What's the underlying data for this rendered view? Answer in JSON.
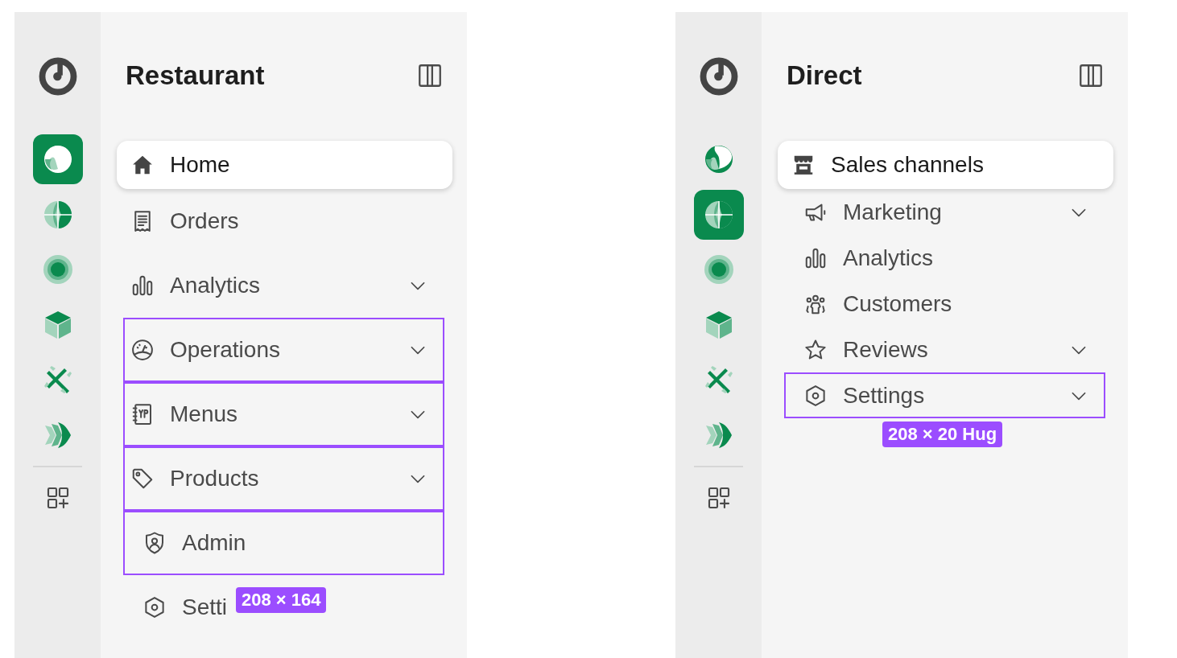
{
  "panels": [
    {
      "title": "Restaurant",
      "rail": [
        {
          "selected": true
        },
        {
          "selected": false
        },
        {
          "selected": false
        },
        {
          "selected": false
        },
        {
          "selected": false
        },
        {
          "selected": false
        }
      ],
      "items": [
        {
          "kind": "item",
          "label": "Home",
          "selected": true,
          "expandable": false,
          "outlined": false
        },
        {
          "kind": "item",
          "label": "Orders",
          "selected": false,
          "expandable": false,
          "outlined": false
        },
        {
          "kind": "item",
          "label": "Analytics",
          "selected": false,
          "expandable": true,
          "outlined": false
        },
        {
          "kind": "item",
          "label": "Operations",
          "selected": false,
          "expandable": true,
          "outlined": true
        },
        {
          "kind": "item",
          "label": "Menus",
          "selected": false,
          "expandable": true,
          "outlined": true
        },
        {
          "kind": "item",
          "label": "Products",
          "selected": false,
          "expandable": true,
          "outlined": true
        },
        {
          "kind": "sub",
          "label": "Admin",
          "selected": false,
          "expandable": false,
          "outlined": true
        },
        {
          "kind": "sub",
          "label": "Setti",
          "selected": false,
          "expandable": false,
          "outlined": false
        }
      ],
      "size_badge": "208 × 164"
    },
    {
      "title": "Direct",
      "rail": [
        {
          "selected": false
        },
        {
          "selected": true
        },
        {
          "selected": false
        },
        {
          "selected": false
        },
        {
          "selected": false
        },
        {
          "selected": false
        }
      ],
      "items": [
        {
          "kind": "item",
          "label": "Sales channels",
          "selected": true,
          "expandable": false,
          "outlined": false
        },
        {
          "kind": "sub",
          "label": "Marketing",
          "selected": false,
          "expandable": true,
          "outlined": false
        },
        {
          "kind": "sub",
          "label": "Analytics",
          "selected": false,
          "expandable": false,
          "outlined": false
        },
        {
          "kind": "sub",
          "label": "Customers",
          "selected": false,
          "expandable": false,
          "outlined": false
        },
        {
          "kind": "sub",
          "label": "Reviews",
          "selected": false,
          "expandable": true,
          "outlined": false
        },
        {
          "kind": "sub",
          "label": "Settings",
          "selected": false,
          "expandable": true,
          "outlined": true
        }
      ],
      "size_badge": "208 × 20 Hug"
    }
  ]
}
